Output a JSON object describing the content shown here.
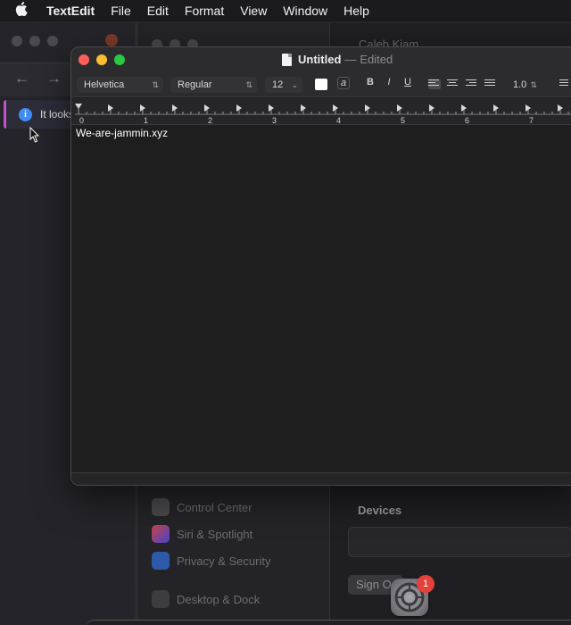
{
  "menubar": {
    "apple_icon": "apple-icon",
    "app_name": "TextEdit",
    "items": [
      "File",
      "Edit",
      "Format",
      "View",
      "Window",
      "Help"
    ]
  },
  "browser": {
    "back_icon": "back-arrow-icon",
    "forward_icon": "forward-arrow-icon",
    "banner_text": "It looks"
  },
  "settings": {
    "user_name": "Caleb Kiam",
    "sidebar_items": [
      "Control Center",
      "Siri & Spotlight",
      "Privacy & Security",
      "Desktop & Dock"
    ],
    "devices_label": "Devices",
    "sign_out_label": "Sign Out"
  },
  "dock": {
    "icon": "system-settings-icon",
    "badge_count": "1"
  },
  "textedit": {
    "title": "Untitled",
    "separator": "—",
    "state": "Edited",
    "font_family": "Helvetica",
    "font_style": "Regular",
    "font_size": "12",
    "bold_label": "B",
    "italic_label": "I",
    "underline_label": "U",
    "line_spacing": "1.0",
    "ruler_numbers": [
      "0",
      "1",
      "2",
      "3",
      "4",
      "5",
      "6",
      "7"
    ],
    "body_text": "We-are-jammin.xyz",
    "colors": {
      "close": "#ff5f57",
      "minimize": "#febc2e",
      "zoom": "#28c840",
      "text_color_well": "#ffffff"
    }
  }
}
